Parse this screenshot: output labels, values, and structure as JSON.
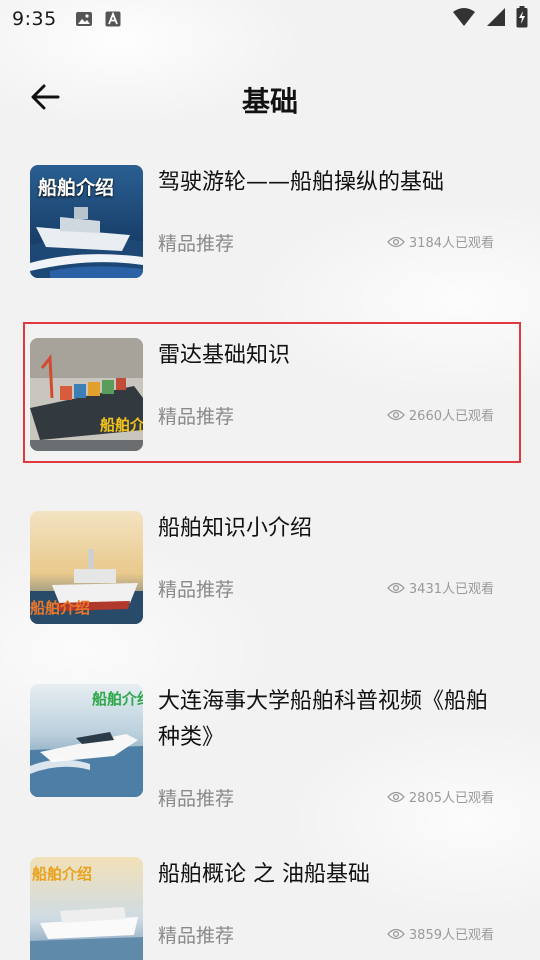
{
  "status_bar": {
    "time": "9:35",
    "icons": [
      "image-icon",
      "a-badge-icon",
      "wifi-icon",
      "signal-icon",
      "battery-charging-icon"
    ]
  },
  "header": {
    "title": "基础",
    "back_icon": "back-arrow-icon"
  },
  "items": [
    {
      "title": "驾驶游轮——船舶操纵的基础",
      "tag": "精品推荐",
      "views": "3184人已观看",
      "thumb_text": "船舶介绍"
    },
    {
      "title": "雷达基础知识",
      "tag": "精品推荐",
      "views": "2660人已观看",
      "thumb_text": "船舶介绍",
      "selected": true
    },
    {
      "title": "船舶知识小介绍",
      "tag": "精品推荐",
      "views": "3431人已观看",
      "thumb_text": "船舶介绍"
    },
    {
      "title": "大连海事大学船舶科普视频《船舶种类》",
      "tag": "精品推荐",
      "views": "2805人已观看",
      "thumb_text": "船舶介绍"
    },
    {
      "title": "船舶概论 之 油船基础",
      "tag": "精品推荐",
      "views": "3859人已观看",
      "thumb_text": "船舶介绍"
    }
  ],
  "colors": {
    "highlight": "#e0393e",
    "title": "#111111",
    "tag": "#8a8a8a",
    "views": "#9a9a9a"
  }
}
